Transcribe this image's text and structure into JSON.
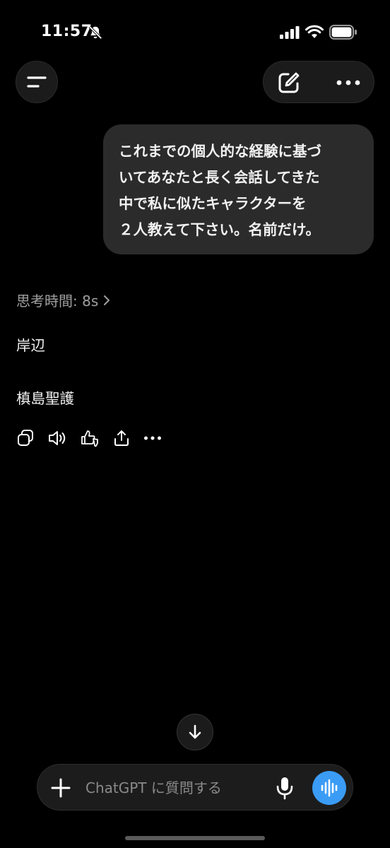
{
  "status_bar": {
    "time": "11:57",
    "icons": [
      "bell-slash-icon",
      "signal-icon",
      "wifi-icon",
      "battery-icon"
    ]
  },
  "header": {
    "icons": [
      "menu-icon",
      "compose-icon",
      "more-icon"
    ]
  },
  "conversation": {
    "user_message": {
      "lines": [
        "これまでの個人的な経験に基づ",
        "いてあなたと長く会話してきた",
        "中で私に似たキャラクターを",
        "２人教えて下さい。名前だけ。"
      ]
    },
    "thinking_label": "思考時間: 8s",
    "answers": [
      "岸辺",
      "槙島聖護"
    ],
    "action_icons": [
      "copy-icon",
      "read-aloud-icon",
      "feedback-icon",
      "share-icon",
      "more-icon"
    ]
  },
  "composer": {
    "placeholder": "ChatGPT に質問する",
    "value": "",
    "icons": [
      "plus-icon",
      "mic-icon",
      "voice-mode-icon"
    ]
  },
  "colors": {
    "background": "#000000",
    "bubble": "#2b2b2b",
    "accent": "#3b9cf5"
  }
}
